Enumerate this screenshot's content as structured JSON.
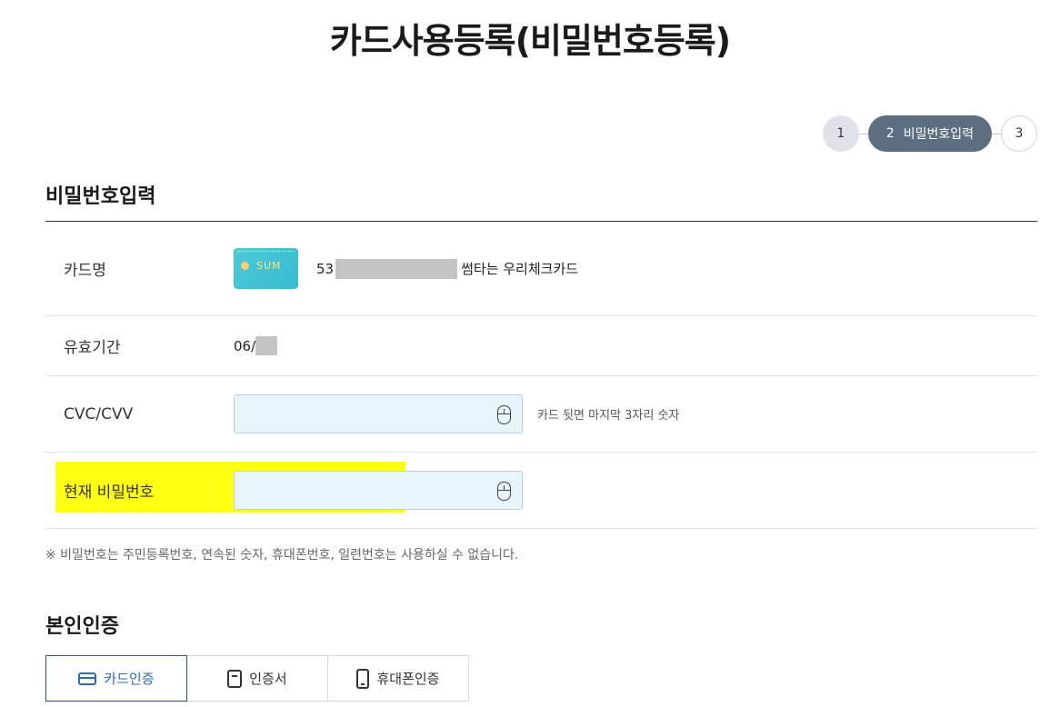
{
  "page": {
    "title": "카드사용등록(비밀번호등록)"
  },
  "steps": [
    {
      "number": "1",
      "state": "done"
    },
    {
      "number": "2",
      "label": "비밀번호입력",
      "state": "active"
    },
    {
      "number": "3",
      "state": "pending"
    }
  ],
  "password_section": {
    "title": "비밀번호입력",
    "card_row": {
      "label": "카드명",
      "card_brand": "SUM",
      "card_number_prefix": "53",
      "card_name": "썸타는 우리체크카드"
    },
    "expiry_row": {
      "label": "유효기간",
      "value_prefix": "06/"
    },
    "cvc_row": {
      "label": "CVC/CVV",
      "input_value": "",
      "hint": "카드 뒷면 마지막 3자리 숫자",
      "icon": "mouse-icon"
    },
    "password_row": {
      "label": "현재 비밀번호",
      "input_value": "",
      "icon": "mouse-icon"
    },
    "notice": "※ 비밀번호는 주민등록번호, 연속된 숫자, 휴대폰번호, 일련번호는 사용하실 수 없습니다."
  },
  "auth_section": {
    "title": "본인인증",
    "tabs": [
      {
        "label": "카드인증",
        "icon": "card-icon",
        "active": true
      },
      {
        "label": "인증서",
        "icon": "certificate-icon",
        "active": false
      },
      {
        "label": "휴대폰인증",
        "icon": "phone-icon",
        "active": false
      }
    ]
  },
  "colors": {
    "active_step": "#5b6e82",
    "input_bg": "#e8f4fc",
    "highlight": "#ffff00",
    "active_tab_text": "#2e6bb0"
  }
}
